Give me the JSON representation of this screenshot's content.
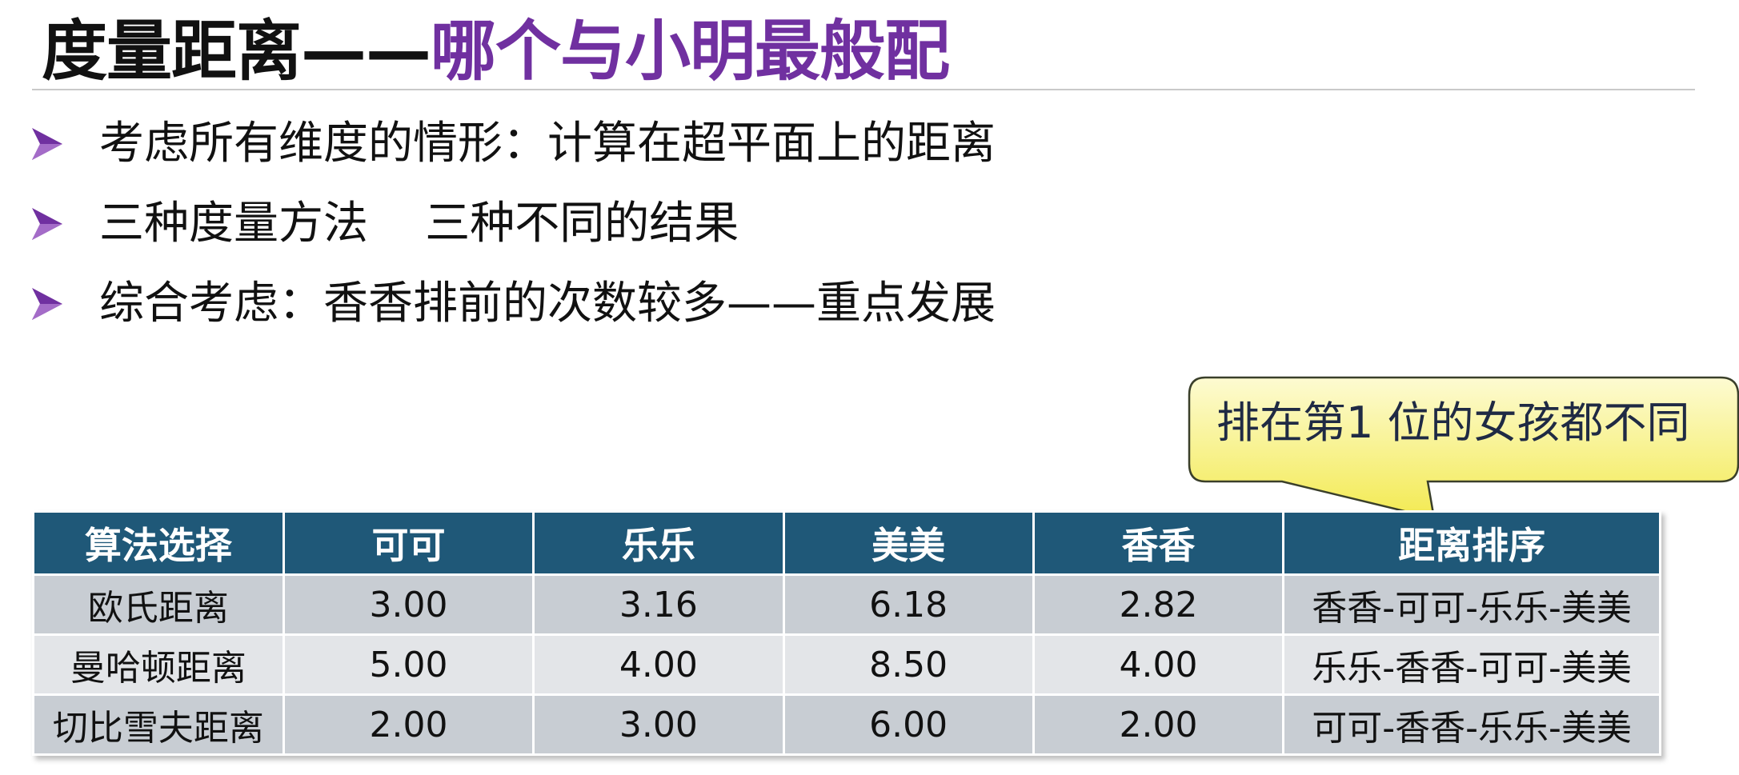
{
  "title": {
    "part1": "度量距离——",
    "part2": "哪个与小明最般配"
  },
  "bullets": [
    {
      "text": "考虑所有维度的情形：计算在超平面上的距离"
    },
    {
      "text": "三种度量方法    三种不同的结果"
    },
    {
      "text": "综合考虑：香香排前的次数较多——重点发展"
    }
  ],
  "callout": {
    "text": "排在第1 位的女孩都不同"
  },
  "table": {
    "headers": [
      "算法选择",
      "可可",
      "乐乐",
      "美美",
      "香香",
      "距离排序"
    ],
    "rows": [
      [
        "欧氏距离",
        "3.00",
        "3.16",
        "6.18",
        "2.82",
        "香香-可可-乐乐-美美"
      ],
      [
        "曼哈顿距离",
        "5.00",
        "4.00",
        "8.50",
        "4.00",
        "乐乐-香香-可可-美美"
      ],
      [
        "切比雪夫距离",
        "2.00",
        "3.00",
        "6.00",
        "2.00",
        "可可-香香-乐乐-美美"
      ]
    ]
  },
  "colors": {
    "title_dark": "#111111",
    "title_accent": "#7030a0",
    "bullet_arrow": "#7030a0",
    "table_header": "#1f5878",
    "row_odd": "#c8cdd3",
    "row_even": "#e3e5e8",
    "callout_fill": "#fbf7a0"
  },
  "icons": {
    "bullet": "triangle-arrow-right-icon"
  }
}
